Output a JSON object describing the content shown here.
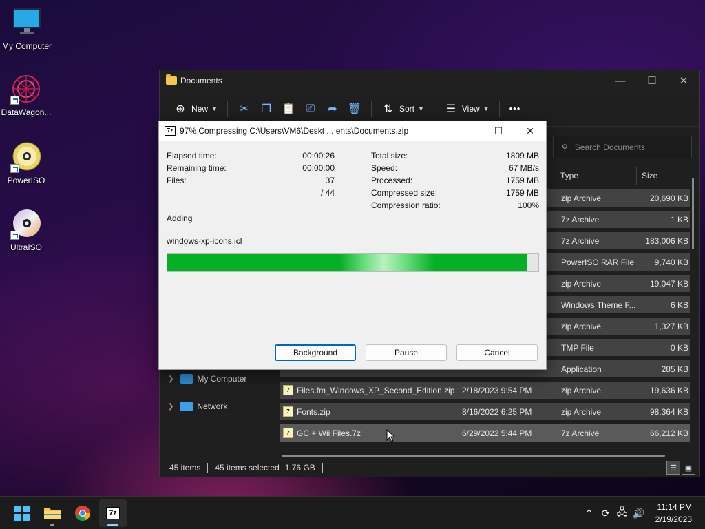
{
  "desktop": {
    "icons": [
      {
        "label": "My Computer"
      },
      {
        "label": "DataWagon..."
      },
      {
        "label": "PowerISO"
      },
      {
        "label": "UltraISO"
      }
    ]
  },
  "explorer": {
    "title": "Documents",
    "toolbar": {
      "new_label": "New",
      "sort_label": "Sort",
      "view_label": "View",
      "more_label": "•••"
    },
    "search_placeholder": "Search Documents",
    "columns": {
      "type": "Type",
      "size": "Size"
    },
    "rows": [
      {
        "name": "",
        "date": "",
        "type": "zip Archive",
        "size": "20,690 KB"
      },
      {
        "name": "",
        "date": "",
        "type": "7z Archive",
        "size": "1 KB"
      },
      {
        "name": "",
        "date": "",
        "type": "7z Archive",
        "size": "183,006 KB"
      },
      {
        "name": "",
        "date": "",
        "type": "PowerISO RAR File",
        "size": "9,740 KB"
      },
      {
        "name": "",
        "date": "",
        "type": "zip Archive",
        "size": "19,047 KB"
      },
      {
        "name": "",
        "date": "",
        "type": "Windows Theme F...",
        "size": "6 KB"
      },
      {
        "name": "",
        "date": "",
        "type": "zip Archive",
        "size": "1,327 KB"
      },
      {
        "name": "",
        "date": "",
        "type": "TMP File",
        "size": "0 KB"
      },
      {
        "name": "",
        "date": "",
        "type": "Application",
        "size": "285 KB"
      },
      {
        "name": "Files.fm_Windows_XP_Second_Edition.zip",
        "date": "2/18/2023 9:54 PM",
        "type": "zip Archive",
        "size": "19,636 KB"
      },
      {
        "name": "Fonts.zip",
        "date": "8/16/2022 6:25 PM",
        "type": "zip Archive",
        "size": "98,364 KB"
      },
      {
        "name": "GC + Wii Files.7z",
        "date": "6/29/2022 5:44 PM",
        "type": "7z Archive",
        "size": "66,212 KB"
      }
    ],
    "nav": [
      {
        "label": "My Computer"
      },
      {
        "label": "Network"
      }
    ],
    "status": {
      "items": "45 items",
      "selected": "45 items selected",
      "size": "1.76 GB"
    }
  },
  "dialog": {
    "title": "97% Compressing C:\\Users\\VM6\\Deskt ... ents\\Documents.zip",
    "left_stats": [
      {
        "label": "Elapsed time:",
        "value": "00:00:26"
      },
      {
        "label": "Remaining time:",
        "value": "00:00:00"
      },
      {
        "label": "Files:",
        "value": "37"
      },
      {
        "label": "",
        "value": "/ 44"
      }
    ],
    "right_stats": [
      {
        "label": "Total size:",
        "value": "1809 MB"
      },
      {
        "label": "Speed:",
        "value": "67 MB/s"
      },
      {
        "label": "Processed:",
        "value": "1759 MB"
      },
      {
        "label": "Compressed size:",
        "value": "1759 MB"
      },
      {
        "label": "Compression ratio:",
        "value": "100%"
      }
    ],
    "action": "Adding",
    "current_file": "windows-xp-icons.icl",
    "progress": 0.97,
    "buttons": {
      "background": "Background",
      "pause": "Pause",
      "cancel": "Cancel"
    }
  },
  "taskbar": {
    "app_7z_label": "7z",
    "clock_time": "11:14 PM",
    "clock_date": "2/19/2023"
  }
}
